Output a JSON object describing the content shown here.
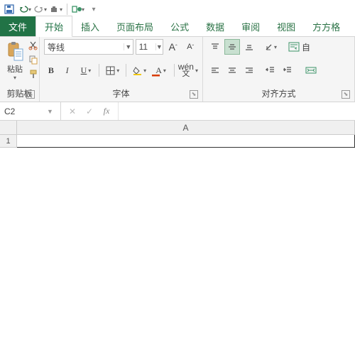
{
  "qat": {
    "save": "save",
    "undo": "undo",
    "redo": "redo"
  },
  "tabs": {
    "file": "文件",
    "home": "开始",
    "insert": "插入",
    "layout": "页面布局",
    "formula": "公式",
    "data": "数据",
    "review": "审阅",
    "view": "视图",
    "ffgrid": "方方格"
  },
  "clipboard": {
    "paste": "粘贴",
    "label": "剪贴板"
  },
  "font": {
    "name": "等线",
    "size": "11",
    "label": "字体",
    "bold": "B",
    "italic": "I",
    "underline": "U"
  },
  "align": {
    "label": "对齐方式",
    "wrap": "自"
  },
  "namebox": {
    "ref": "C2"
  },
  "formula": {
    "value": ""
  },
  "grid": {
    "colA": "A",
    "row1": "1"
  },
  "phonetic": "wén"
}
